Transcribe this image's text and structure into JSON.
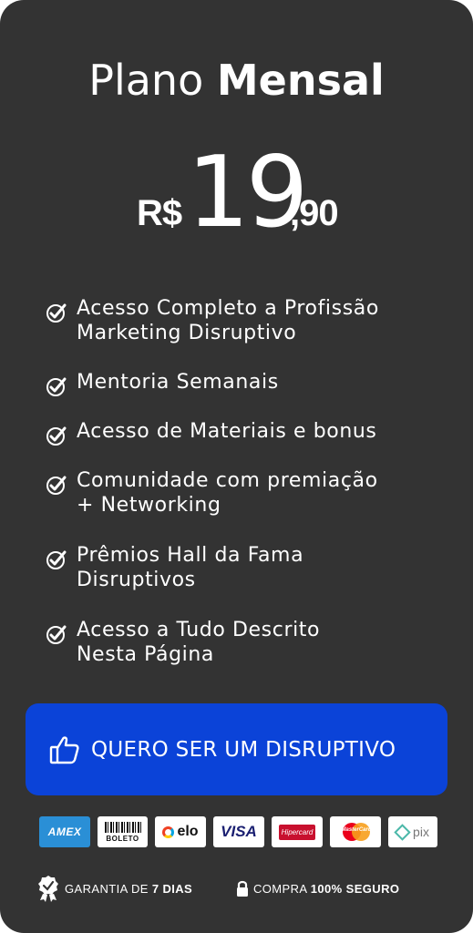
{
  "plan": {
    "title_light": "Plano ",
    "title_bold": "Mensal",
    "currency": "R$",
    "price_integer": "19",
    "price_cents": ",90"
  },
  "features": [
    {
      "text": "Acesso Completo a Profissão\nMarketing Disruptivo",
      "icon": "check-icon"
    },
    {
      "text": "Mentoria Semanais",
      "icon": "check-icon"
    },
    {
      "text": "Acesso de Materiais  e bonus",
      "icon": "check-icon"
    },
    {
      "text": "Comunidade com premiação\n+ Networking",
      "icon": "check-icon"
    },
    {
      "text": "Prêmios Hall da Fama\nDisruptivos",
      "icon": "check-icon"
    },
    {
      "text": "Acesso a Tudo Descrito\nNesta Página",
      "icon": "check-icon"
    }
  ],
  "cta": {
    "label": "QUERO SER UM DISRUPTIVO",
    "icon": "thumbs-up-icon",
    "color": "#0b43d8"
  },
  "payments": {
    "amex": "AMEX",
    "boleto": "BOLETO",
    "elo": "elo",
    "visa": "VISA",
    "hipercard": "Hipercard",
    "mastercard": "MasterCard",
    "pix": "pix"
  },
  "footer": {
    "guarantee_prefix": "GARANTIA DE ",
    "guarantee_bold": "7 DIAS",
    "secure_prefix": "COMPRA ",
    "secure_bold": "100% SEGURO"
  }
}
